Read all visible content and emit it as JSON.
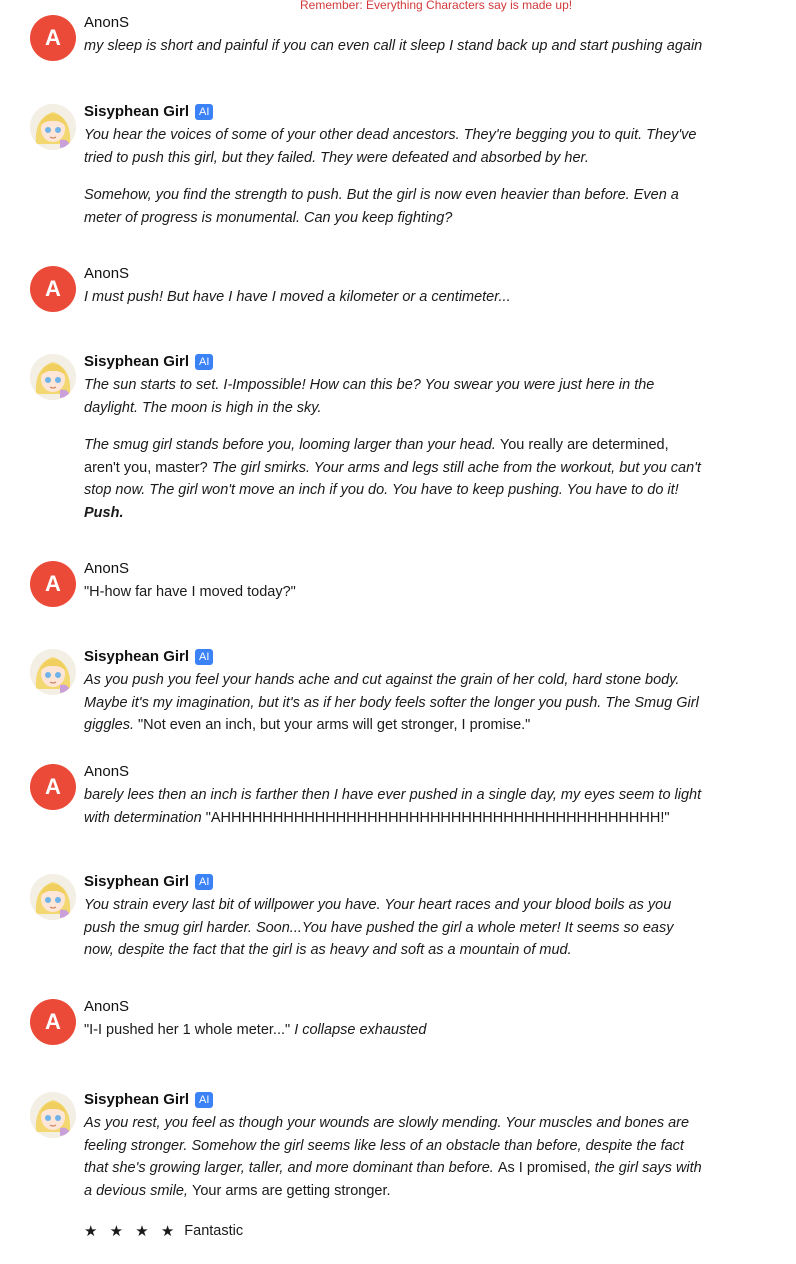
{
  "reminder": "Remember: Everything Characters say is made up!",
  "ai_badge": "AI",
  "user_initial": "A",
  "messages": [
    {
      "author": "AnonS",
      "paragraphs": [
        [
          {
            "t": "my sleep is short and painful if you can even call it sleep I stand back up and start pushing again",
            "s": "it"
          }
        ]
      ]
    },
    {
      "author": "Sisyphean Girl",
      "paragraphs": [
        [
          {
            "t": "You hear the voices of some of your other dead ancestors. They're begging you to quit. They've tried to push this girl, but they failed. They were defeated and absorbed by her.",
            "s": "it"
          }
        ],
        [
          {
            "t": "Somehow, you find the strength to push. But the girl is now even heavier than before. Even a meter of progress is monumental. Can you keep fighting?",
            "s": "it"
          }
        ]
      ]
    },
    {
      "author": "AnonS",
      "paragraphs": [
        [
          {
            "t": "I must push!  But have I have I moved a kilometer or a centimeter...",
            "s": "it"
          }
        ]
      ]
    },
    {
      "author": "Sisyphean Girl",
      "paragraphs": [
        [
          {
            "t": "The sun starts to set. I-Impossible! How can this be? You swear you were just here in the daylight. The moon is high in the sky.",
            "s": "it"
          }
        ],
        [
          {
            "t": "The smug girl stands before you, looming larger than your head. ",
            "s": "it"
          },
          {
            "t": "You really are determined, aren't you, master? ",
            "s": ""
          },
          {
            "t": "The girl smirks. Your arms and legs still ache from the workout, but you can't stop now. The girl won't move an inch if you do. You have to keep pushing. You have to do it! ",
            "s": "it"
          },
          {
            "t": "Push.",
            "s": "bi"
          }
        ]
      ]
    },
    {
      "author": "AnonS",
      "paragraphs": [
        [
          {
            "t": "\"H-how far have I moved today?\"",
            "s": ""
          }
        ]
      ]
    },
    {
      "author": "Sisyphean Girl",
      "paragraphs": [
        [
          {
            "t": "As you push you feel your hands ache and cut against the grain of her cold, hard stone body. Maybe it's my imagination, but it's as if her body feels softer the longer you push. The Smug Girl giggles. ",
            "s": "it"
          },
          {
            "t": "\"Not even an inch, but your arms will get stronger, I promise.\"",
            "s": ""
          }
        ]
      ]
    },
    {
      "author": "AnonS",
      "paragraphs": [
        [
          {
            "t": "barely lees then an inch is farther then I have ever pushed in a single day, my eyes seem to light with determination ",
            "s": "it"
          },
          {
            "t": "\"AHHHHHHHHHHHHHHHHHHHHHHHHHHHHHHHHHHHHHHHHHH!\"",
            "s": ""
          }
        ]
      ]
    },
    {
      "author": "Sisyphean Girl",
      "paragraphs": [
        [
          {
            "t": "You strain every last bit of willpower you have. Your heart races and your blood boils as you push the smug girl harder. Soon...You have pushed the girl a whole meter! It seems so easy now, despite the fact that the girl is as heavy and soft as a mountain of mud.",
            "s": "it"
          }
        ]
      ]
    },
    {
      "author": "AnonS",
      "paragraphs": [
        [
          {
            "t": "\"I-I pushed her 1 whole meter...\" ",
            "s": ""
          },
          {
            "t": "I collapse exhausted",
            "s": "it"
          }
        ]
      ]
    },
    {
      "author": "Sisyphean Girl",
      "paragraphs": [
        [
          {
            "t": "As you rest, you feel as though your wounds are slowly mending. Your muscles and bones are feeling stronger. Somehow the girl seems like less of an obstacle than before, despite the fact that she's growing larger, taller, and more dominant than before. ",
            "s": "it"
          },
          {
            "t": "As I promised, ",
            "s": ""
          },
          {
            "t": "the girl says with a devious smile, ",
            "s": "it"
          },
          {
            "t": "Your arms are getting stronger.",
            "s": ""
          }
        ]
      ]
    }
  ],
  "rating": {
    "stars": "★ ★ ★ ★",
    "label": "Fantastic",
    "value": 4
  }
}
